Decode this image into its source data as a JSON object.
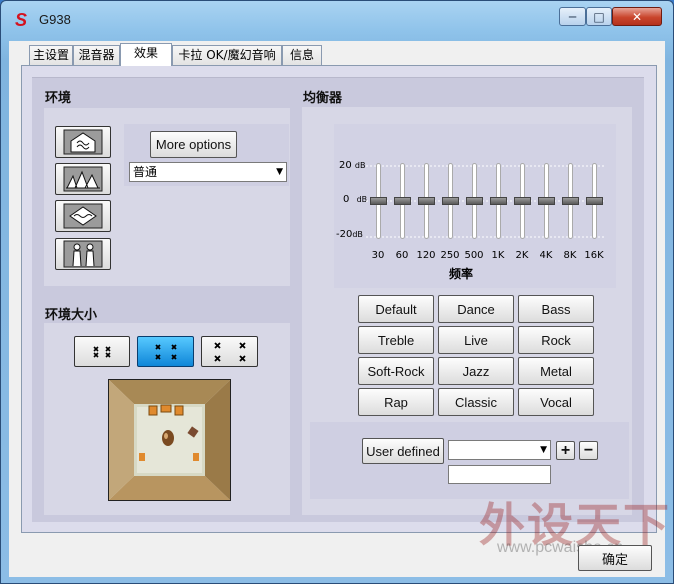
{
  "window": {
    "title": "G938",
    "close_glyph": "✕",
    "minimize_glyph": "─",
    "maximize_glyph": "□"
  },
  "tabs": [
    {
      "label": "主设置",
      "active": false
    },
    {
      "label": "混音器",
      "active": false
    },
    {
      "label": "效果",
      "active": true
    },
    {
      "label": "卡拉 OK/魔幻音响",
      "active": false
    },
    {
      "label": "信息",
      "active": false
    }
  ],
  "environment": {
    "title": "环境",
    "more_options_label": "More options",
    "preset_value": "普通",
    "icons": [
      "bathroom-icon",
      "opera-house-icon",
      "underwater-icon",
      "concert-hall-icon"
    ]
  },
  "room_size": {
    "title": "环境大小",
    "options": [
      "small-room-icon",
      "medium-room-icon",
      "large-room-icon"
    ],
    "selected_index": 1
  },
  "equalizer": {
    "title": "均衡器",
    "db_labels": [
      "20",
      "0",
      "-20"
    ],
    "db_unit": "dB",
    "frequencies": [
      "30",
      "60",
      "120",
      "250",
      "500",
      "1K",
      "2K",
      "4K",
      "8K",
      "16K"
    ],
    "gains_db": [
      0,
      0,
      0,
      0,
      0,
      0,
      0,
      0,
      0,
      0
    ],
    "axis_label": "频率",
    "presets": [
      "Default",
      "Dance",
      "Bass",
      "Treble",
      "Live",
      "Rock",
      "Soft-Rock",
      "Jazz",
      "Metal",
      "Rap",
      "Classic",
      "Vocal"
    ],
    "user_defined_label": "User defined",
    "user_select_value": "",
    "user_name_value": "",
    "add_glyph": "+",
    "remove_glyph": "−"
  },
  "footer": {
    "ok_label": "确定"
  },
  "watermark": {
    "text": "外设天下",
    "url": "www.pcwaishe.cn"
  }
}
